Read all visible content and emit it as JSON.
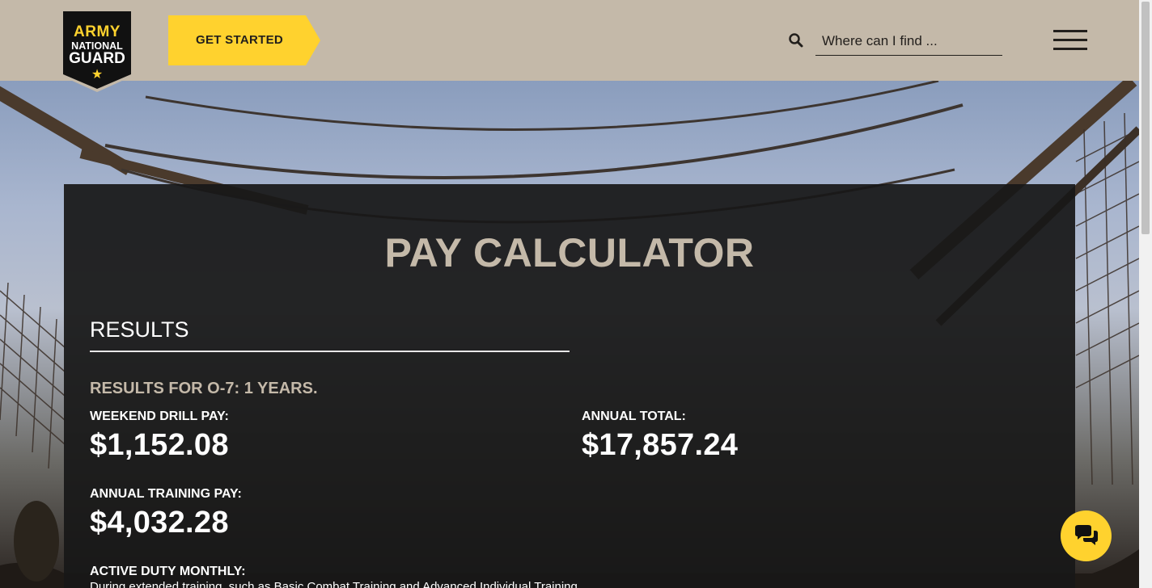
{
  "header": {
    "logo": {
      "line1": "ARMY",
      "line2": "NATIONAL",
      "line3": "GUARD",
      "star": "★"
    },
    "cta_label": "GET STARTED",
    "search": {
      "icon": "search-icon",
      "placeholder": "Where can I find ..."
    },
    "menu_icon": "hamburger-icon"
  },
  "main": {
    "title": "PAY CALCULATOR",
    "results_heading": "RESULTS",
    "results_for": "RESULTS FOR O-7: 1 YEARS.",
    "weekend_drill": {
      "label": "WEEKEND DRILL PAY:",
      "amount": "$1,152.08"
    },
    "annual_total": {
      "label": "ANNUAL TOTAL:",
      "amount": "$17,857.24"
    },
    "annual_training": {
      "label": "ANNUAL TRAINING PAY:",
      "amount": "$4,032.28"
    },
    "active_duty": {
      "label": "ACTIVE DUTY MONTHLY:",
      "note": "During extended training, such as Basic Combat Training and Advanced Individual Training"
    }
  },
  "chat": {
    "icon": "chat-bubbles-icon"
  },
  "colors": {
    "header_bg": "#c4b9a9",
    "accent_yellow": "#ffd22e",
    "card_bg": "#181818",
    "title_tan": "#c4b9a9"
  }
}
